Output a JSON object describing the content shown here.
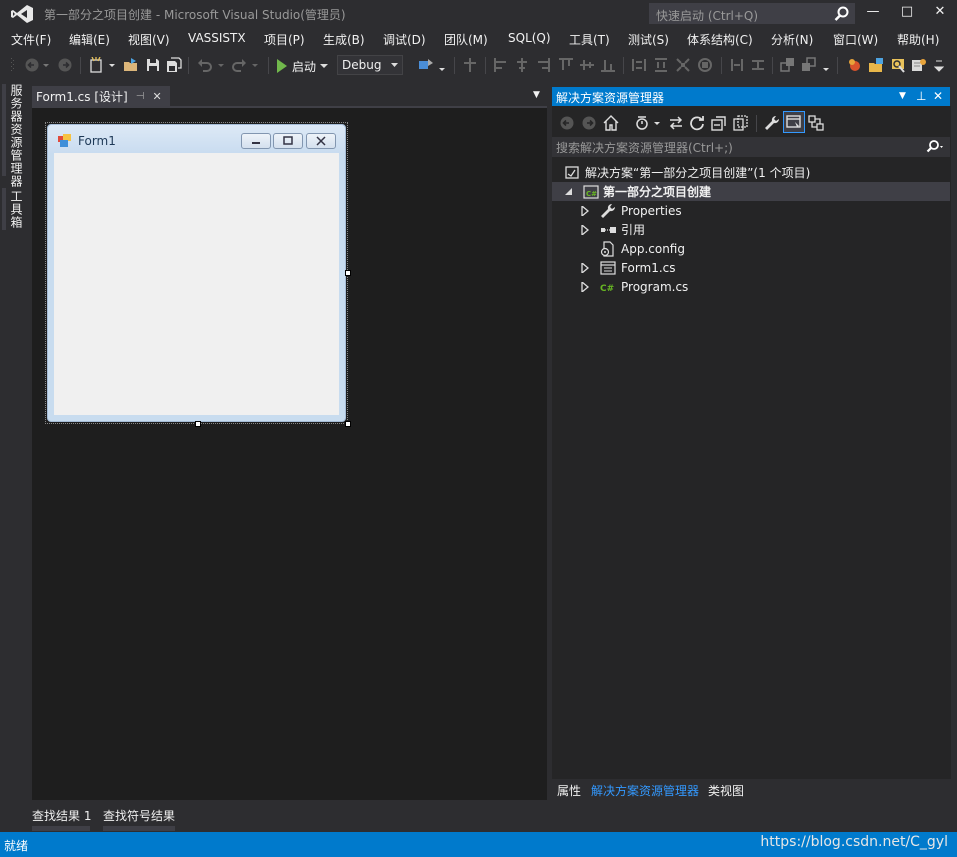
{
  "window": {
    "title": "第一部分之项目创建 - Microsoft Visual Studio(管理员)",
    "quick_launch_placeholder": "快速启动 (Ctrl+Q)",
    "buttons": {
      "minimize": "—",
      "maximize": "□",
      "close": "✕"
    }
  },
  "menu": {
    "items": [
      "文件(F)",
      "编辑(E)",
      "视图(V)",
      "VASSISTX",
      "项目(P)",
      "生成(B)",
      "调试(D)",
      "团队(M)",
      "SQL(Q)",
      "工具(T)",
      "测试(S)",
      "体系结构(C)",
      "分析(N)",
      "窗口(W)",
      "帮助(H)"
    ]
  },
  "toolbar": {
    "start_label": "启动",
    "config_value": "Debug"
  },
  "left_tabs": [
    "服务器资源管理器",
    "工具箱"
  ],
  "document": {
    "tab_label": "Form1.cs [设计]",
    "pin_glyph": "⊣",
    "close_glyph": "✕",
    "overflow_glyph": "▼",
    "form_title": "Form1"
  },
  "solution_explorer": {
    "title": "解决方案资源管理器",
    "header_glyphs": {
      "dropdown": "▼",
      "pin": "⊥",
      "close": "✕"
    },
    "search_placeholder": "搜索解决方案资源管理器(Ctrl+;)",
    "tree": [
      {
        "label": "解决方案“第一部分之项目创建”(1 个项目)",
        "icon": "solution-icon",
        "expander": "none",
        "selected": false
      },
      {
        "label": "第一部分之项目创建",
        "icon": "csharp-project-icon",
        "expander": "expanded",
        "selected": true
      },
      {
        "label": "Properties",
        "icon": "wrench-icon",
        "expander": "collapsed",
        "selected": false
      },
      {
        "label": "引用",
        "icon": "references-icon",
        "expander": "collapsed",
        "selected": false
      },
      {
        "label": "App.config",
        "icon": "config-file-icon",
        "expander": "none",
        "selected": false
      },
      {
        "label": "Form1.cs",
        "icon": "form-file-icon",
        "expander": "collapsed",
        "selected": false
      },
      {
        "label": "Program.cs",
        "icon": "csharp-file-icon",
        "expander": "collapsed",
        "selected": false
      }
    ],
    "bottom_tabs": [
      "属性",
      "解决方案资源管理器",
      "类视图"
    ],
    "active_tab_color": "#3399ff"
  },
  "bottom_tabs": [
    "查找结果 1",
    "查找符号结果"
  ],
  "status": {
    "text": "就绪",
    "watermark": "https://blog.csdn.net/C_gyl"
  },
  "colors": {
    "accent": "#007acc",
    "chrome": "#2d2d30",
    "designer_bg": "#1e1e1e",
    "csharp_green": "#68b723"
  }
}
